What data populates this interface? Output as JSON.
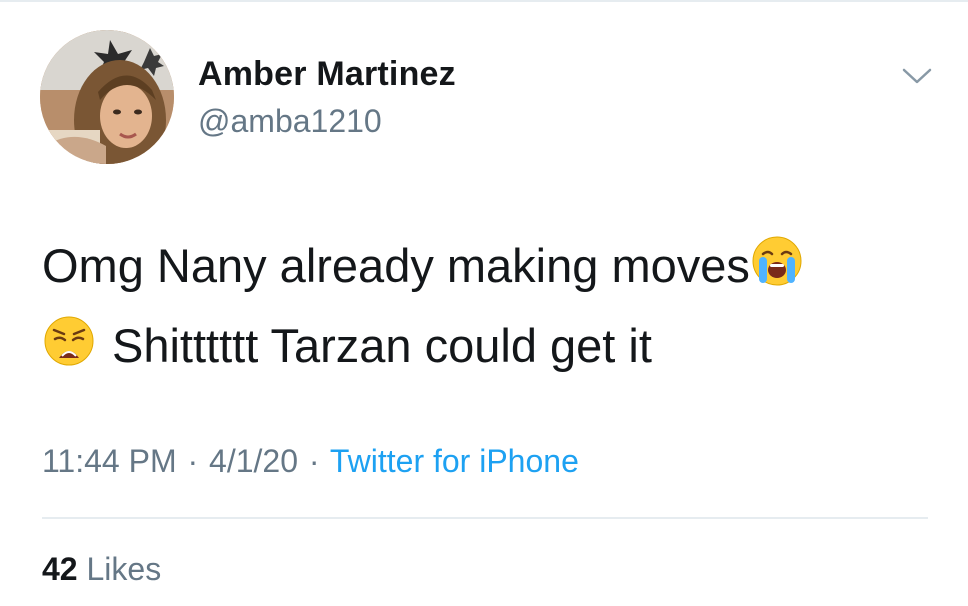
{
  "tweet": {
    "author": {
      "display_name": "Amber Martinez",
      "handle": "@amba1210"
    },
    "text": {
      "line1": "Omg Nany already making moves",
      "line1_emoji": "crying-face-emoji",
      "line2_emoji": "weary-face-emoji",
      "line2": "Shitttttt Tarzan could get it"
    },
    "meta": {
      "time": "11:44 PM",
      "separator": "·",
      "date": "4/1/20",
      "source": "Twitter for iPhone"
    },
    "likes": {
      "count": "42",
      "label": "Likes"
    },
    "menu_icon": "chevron-down-icon"
  },
  "colors": {
    "text": "#14171a",
    "secondary": "#657786",
    "link": "#1da1f2",
    "divider": "#e6ecf0"
  }
}
